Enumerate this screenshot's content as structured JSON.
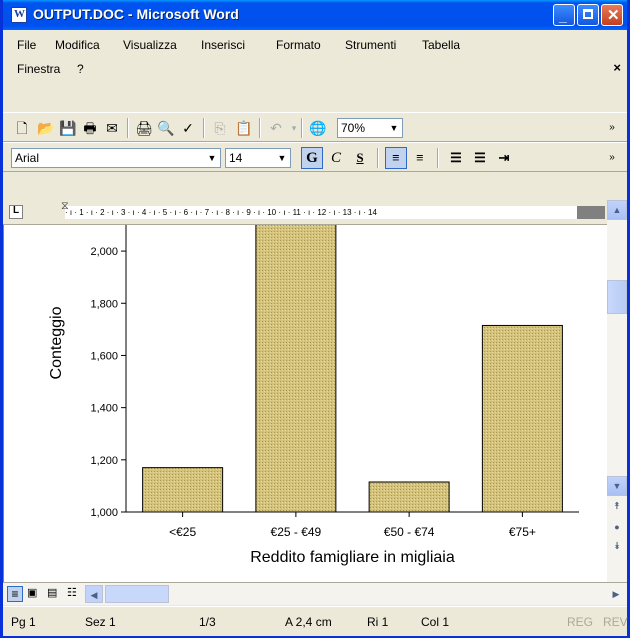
{
  "window": {
    "title": "OUTPUT.DOC - Microsoft Word"
  },
  "menu": {
    "items": [
      "File",
      "Modifica",
      "Visualizza",
      "Inserisci",
      "Formato",
      "Strumenti",
      "Tabella"
    ],
    "row2": [
      "Finestra",
      "?"
    ],
    "close": "×"
  },
  "toolbar": {
    "zoom": "70%"
  },
  "format": {
    "font": "Arial",
    "size": "14",
    "bold": "G",
    "italic": "C",
    "underline": "S"
  },
  "ruler": {
    "ticks": "· ı · 1 · ı · 2 · ı · 3 · ı · 4 · ı · 5 · ı · 6 · ı · 7 · ı · 8 · ı · 9 · ı · 10 · ı · 11 · ı · 12 · ı · 13 · ı · 14"
  },
  "chart_data": {
    "type": "bar",
    "categories": [
      "<€25",
      "€25 - €49",
      "€50 - €74",
      "€75+"
    ],
    "values": [
      1170,
      2120,
      1115,
      1715
    ],
    "xlabel": "Reddito famigliare in migliaia",
    "ylabel": "Conteggio",
    "yticks": [
      "2,000",
      "1,800",
      "1,600",
      "1,400",
      "1,200",
      "1,000"
    ],
    "ylim": [
      1000,
      2100
    ],
    "bar_color": "#d4c27a"
  },
  "status": {
    "page": "Pg 1",
    "section": "Sez 1",
    "pages": "1/3",
    "at": "A 2,4 cm",
    "line": "Ri 1",
    "col": "Col 1",
    "rec": "REG",
    "trk": "REV"
  },
  "colors": {
    "titlebar": "#0054e3",
    "chrome": "#ece9d8"
  }
}
